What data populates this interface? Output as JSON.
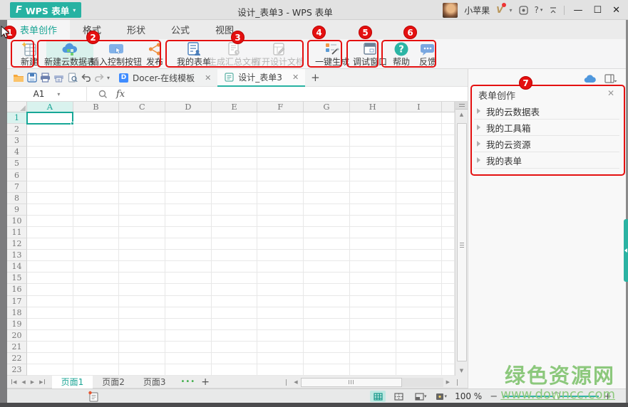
{
  "titlebar": {
    "app_button": "WPS 表单",
    "app_logo": "F",
    "title": "设计_表单3 - WPS 表单",
    "username": "小苹果",
    "vip_mark": "V",
    "help_label": "?",
    "minimize": "—",
    "maximize": "☐",
    "close": "✕"
  },
  "ribbon_tabs": {
    "items": [
      {
        "label": "表单创作",
        "active": true
      },
      {
        "label": "格式",
        "active": false
      },
      {
        "label": "形状",
        "active": false
      },
      {
        "label": "公式",
        "active": false
      },
      {
        "label": "视图",
        "active": false
      }
    ]
  },
  "ribbon": {
    "groups": [
      {
        "buttons": [
          {
            "label": "新建",
            "icon": "new-form-icon",
            "state": "normal"
          }
        ]
      },
      {
        "buttons": [
          {
            "label": "新建云数据表",
            "icon": "cloud-table-icon",
            "state": "selected"
          },
          {
            "label": "插入控制按钮",
            "icon": "insert-control-icon",
            "state": "normal"
          },
          {
            "label": "发布",
            "icon": "publish-icon",
            "state": "normal"
          }
        ]
      },
      {
        "buttons": [
          {
            "label": "我的表单",
            "icon": "my-forms-icon",
            "state": "normal"
          },
          {
            "label": "生成汇总文档",
            "icon": "summary-doc-icon",
            "state": "disabled"
          },
          {
            "label": "打开设计文档",
            "icon": "open-design-doc-icon",
            "state": "disabled"
          }
        ]
      },
      {
        "buttons": [
          {
            "label": "一键生成",
            "icon": "one-key-generate-icon",
            "state": "normal"
          }
        ]
      },
      {
        "buttons": [
          {
            "label": "调试窗口",
            "icon": "debug-window-icon",
            "state": "normal"
          }
        ]
      },
      {
        "buttons": [
          {
            "label": "帮助",
            "icon": "help-icon",
            "state": "normal"
          },
          {
            "label": "反馈",
            "icon": "feedback-icon",
            "state": "normal"
          }
        ]
      }
    ]
  },
  "quick_toolbar": {
    "icons": [
      "open-folder-icon",
      "save-icon",
      "print-icon",
      "print-preview-icon",
      "file-preview-icon",
      "undo-icon",
      "redo-icon",
      "toolbar-dropdown"
    ]
  },
  "doc_tabs": {
    "tabs": [
      {
        "label": "Docer-在线模板",
        "active": false,
        "close": "✕"
      },
      {
        "label": "设计_表单3",
        "active": true,
        "close": "✕"
      }
    ],
    "add": "+"
  },
  "formula_bar": {
    "name_box": "A1",
    "fx_label": "fx"
  },
  "grid": {
    "columns": [
      "A",
      "B",
      "C",
      "D",
      "E",
      "F",
      "G",
      "H",
      "I"
    ],
    "rows": 23,
    "selected_cell": "A1"
  },
  "task_pane": {
    "title": "表单创作",
    "close": "✕",
    "items": [
      "我的云数据表",
      "我的工具箱",
      "我的云资源",
      "我的表单"
    ]
  },
  "sheet_bar": {
    "tabs": [
      {
        "label": "页面1",
        "active": true
      },
      {
        "label": "页面2",
        "active": false
      },
      {
        "label": "页面3",
        "active": false
      }
    ],
    "more": "•••",
    "add": "+"
  },
  "status_bar": {
    "zoom_level": "100 %",
    "zoom_minus": "−",
    "zoom_plus": "+",
    "view_icons": [
      "normal-view-icon",
      "page-break-view-icon",
      "page-layout-view-icon",
      "reading-view-icon"
    ]
  },
  "watermark": {
    "line1": "绿色资源网",
    "line2": "www.downcc.com"
  },
  "annotations": {
    "badges": [
      "1",
      "2",
      "3",
      "4",
      "5",
      "6",
      "7"
    ]
  },
  "colors": {
    "accent_teal": "#27b2a2",
    "annotation_red": "#e41010",
    "watermark_green": "#8cc87c",
    "cloud_blue": "#4f97dd",
    "publish_orange": "#ef8f3f"
  }
}
